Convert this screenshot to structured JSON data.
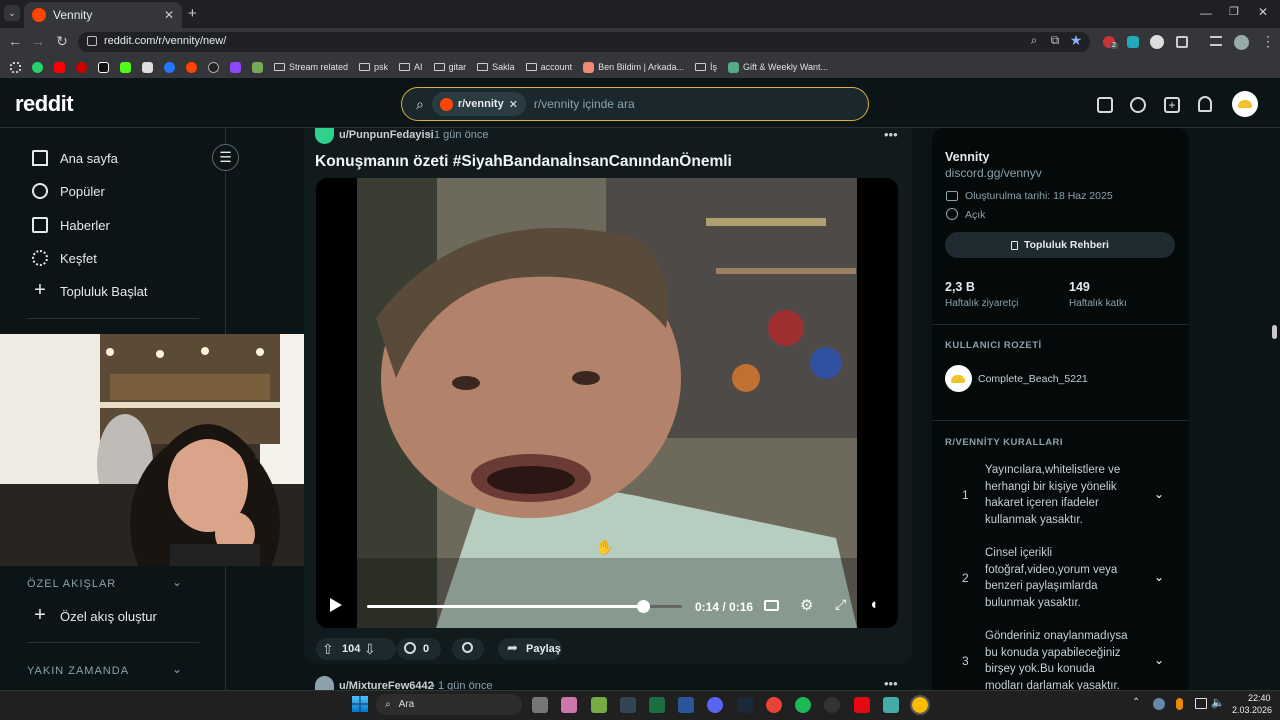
{
  "browser": {
    "tab_title": "Vennity",
    "url": "reddit.com/r/vennity/new/",
    "bookmarks": [
      "Stream related",
      "psk",
      "AI",
      "gitar",
      "Sakla",
      "account",
      "Ben Bildim | Arkada...",
      "İş",
      "Gift & Weekly Want..."
    ],
    "extension_badge": "2"
  },
  "reddit": {
    "logo": "reddit",
    "search": {
      "chip": "r/vennity",
      "placeholder": "r/vennity içinde ara"
    },
    "nav": [
      "Ana sayfa",
      "Popüler",
      "Haberler",
      "Keşfet",
      "Topluluk Başlat"
    ],
    "custom_feeds_header": "ÖZEL AKIŞLAR",
    "create_feed": "Özel akış oluştur",
    "recent_header": "YAKIN ZAMANDA"
  },
  "post": {
    "author": "u/PunpunFedayisi",
    "time": "1 gün önce",
    "title": "Konuşmanın özeti #SiyahBandanaİnsanCanındanÖnemli",
    "video": {
      "current": "0:14",
      "total": "0:16",
      "time_display": "0:14 / 0:16",
      "progress": 0.875
    },
    "upvotes": "104",
    "comments": "0",
    "share": "Paylaş"
  },
  "next_post": {
    "author": "u/MixtureFew6442",
    "time": "1 gün önce"
  },
  "sidebar": {
    "name": "Vennity",
    "link": "discord.gg/vennyv",
    "created": "Oluşturulma tarihi: 18 Haz 2025",
    "visibility": "Açık",
    "guide_button": "Topluluk Rehberi",
    "stats": [
      {
        "value": "2,3 B",
        "label": "Haftalık ziyaretçi"
      },
      {
        "value": "149",
        "label": "Haftalık katkı"
      }
    ],
    "badge_header": "KULLANICI ROZETİ",
    "badge_user": "Complete_Beach_5221",
    "rules_header": "R/VENNİTY KURALLARI",
    "rules": [
      {
        "num": "1",
        "text": "Yayıncılara,whitelistlere ve herhangi bir kişiye yönelik hakaret içeren ifadeler kullanmak yasaktır."
      },
      {
        "num": "2",
        "text": "Cinsel içerikli fotoğraf,video,yorum veya benzeri paylaşımlarda bulunmak yasaktır."
      },
      {
        "num": "3",
        "text": "Gönderiniz onaylanmadıysa bu konuda yapabileceğiniz birşey yok.Bu konuda modları darlamak yasaktır."
      }
    ]
  },
  "taskbar": {
    "search": "Ara",
    "time": "22:40",
    "date": "2.03.2026"
  },
  "colors": {
    "reddit_bg": "#0b1416",
    "search_border": "#d7b33c",
    "brand_orange": "#ff4500"
  }
}
